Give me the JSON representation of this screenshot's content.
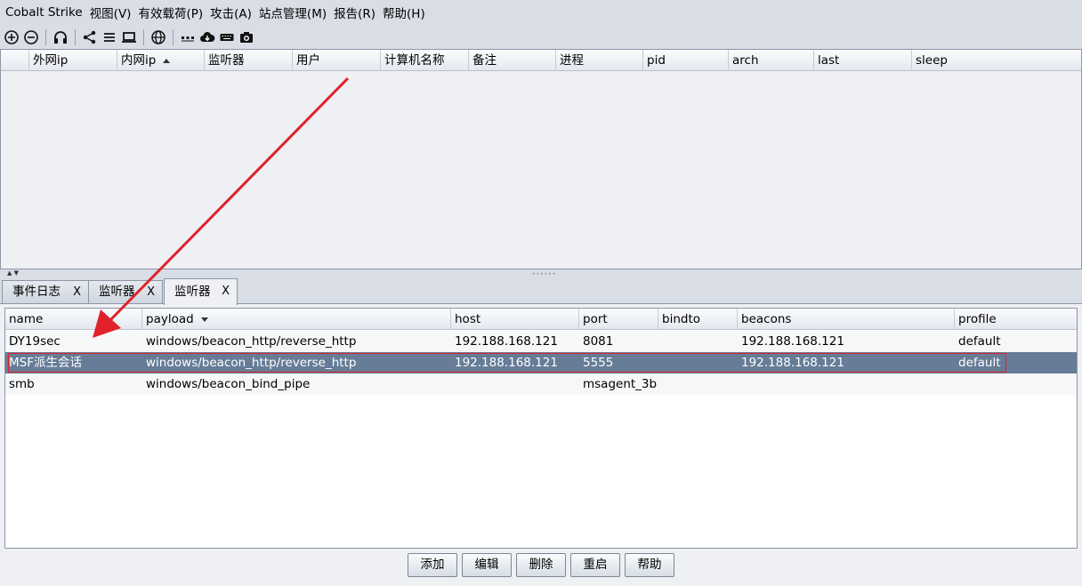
{
  "menu": [
    "Cobalt Strike",
    "视图(V)",
    "有效载荷(P)",
    "攻击(A)",
    "站点管理(M)",
    "报告(R)",
    "帮助(H)"
  ],
  "toolbar": {
    "icons": [
      "add-circle-icon",
      "remove-circle-icon",
      "headphones-icon",
      "share-icon",
      "list-icon",
      "monitor-icon",
      "globe-icon",
      "dots-icon",
      "cloud-download-icon",
      "keyboard-icon",
      "camera-icon"
    ]
  },
  "beacon_table": {
    "columns": [
      "",
      "外网ip",
      "内网ip",
      "监听器",
      "用户",
      "计算机名称",
      "备注",
      "进程",
      "pid",
      "arch",
      "last",
      "sleep"
    ],
    "sorted_column": "内网ip",
    "rows": []
  },
  "tabs": [
    {
      "label": "事件日志",
      "close": "X"
    },
    {
      "label": "监听器",
      "close": "X"
    },
    {
      "label": "监听器",
      "close": "X",
      "active": true
    }
  ],
  "listener_table": {
    "columns": [
      "name",
      "payload",
      "host",
      "port",
      "bindto",
      "beacons",
      "profile"
    ],
    "sorted_column": "payload",
    "rows": [
      {
        "name": "DY19sec",
        "payload": "windows/beacon_http/reverse_http",
        "host": "192.188.168.121",
        "port": "8081",
        "bindto": "",
        "beacons": "192.188.168.121",
        "profile": "default"
      },
      {
        "name": "MSF派生会话",
        "payload": "windows/beacon_http/reverse_http",
        "host": "192.188.168.121",
        "port": "5555",
        "bindto": "",
        "beacons": "192.188.168.121",
        "profile": "default"
      },
      {
        "name": "smb",
        "payload": "windows/beacon_bind_pipe",
        "host": "",
        "port": "msagent_3b",
        "bindto": "",
        "beacons": "",
        "profile": ""
      }
    ]
  },
  "buttons": [
    "添加",
    "编辑",
    "删除",
    "重启",
    "帮助"
  ],
  "colors": {
    "selected_row": "#667c97",
    "annotation": "#e0222a"
  }
}
